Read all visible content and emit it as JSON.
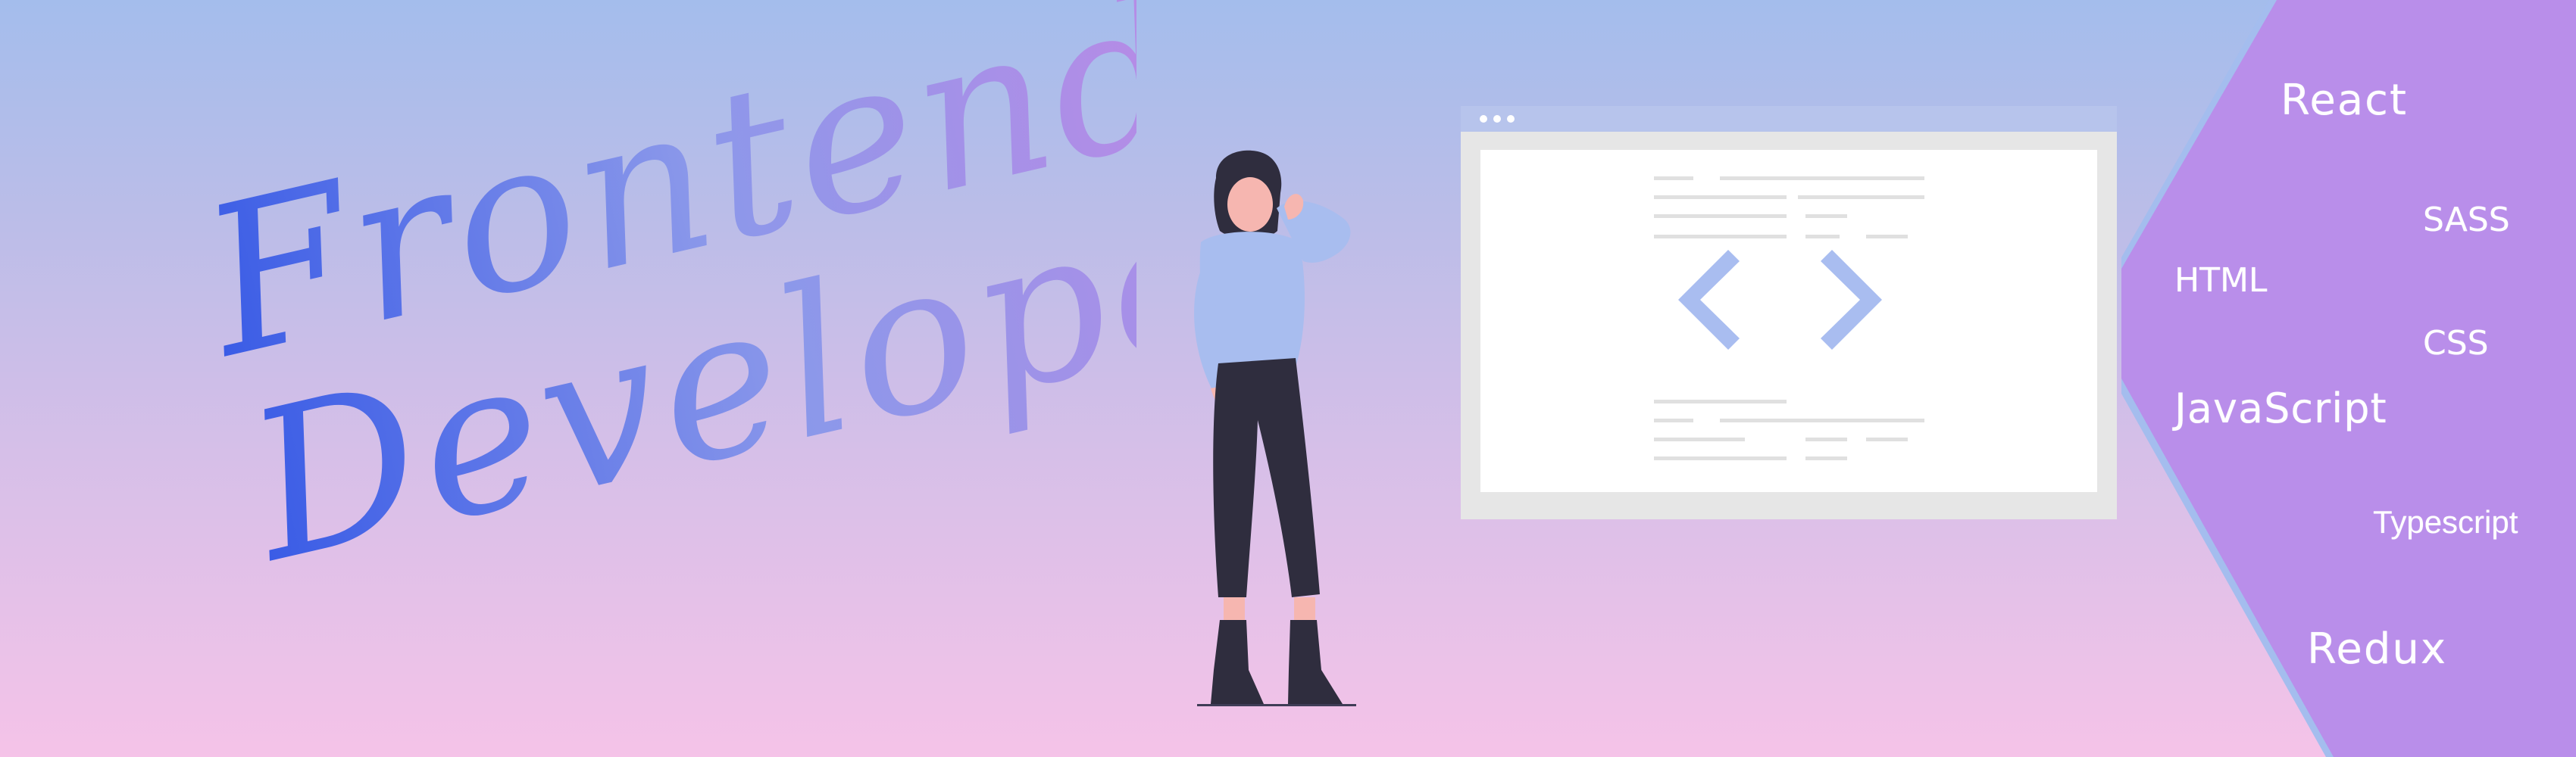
{
  "banner": {
    "title_line1": "Frontend",
    "title_line2": "Developer"
  },
  "skills": {
    "react": "React",
    "sass": "SASS",
    "html": "HTML",
    "css": "CSS",
    "javascript": "JavaScript",
    "typescript": "Typescript",
    "redux": "Redux"
  },
  "colors": {
    "background_top": "#a4bdec",
    "background_bottom": "#f5c3e8",
    "panel_purple": "#b98eea",
    "title_blue": "#3a5ce6",
    "title_purple": "#b88be6",
    "code_icon": "#a9bdf0",
    "person_top": "#a8bdef",
    "person_pants": "#2f2d3e"
  },
  "icons": {
    "code_icon": "code-brackets-icon"
  }
}
